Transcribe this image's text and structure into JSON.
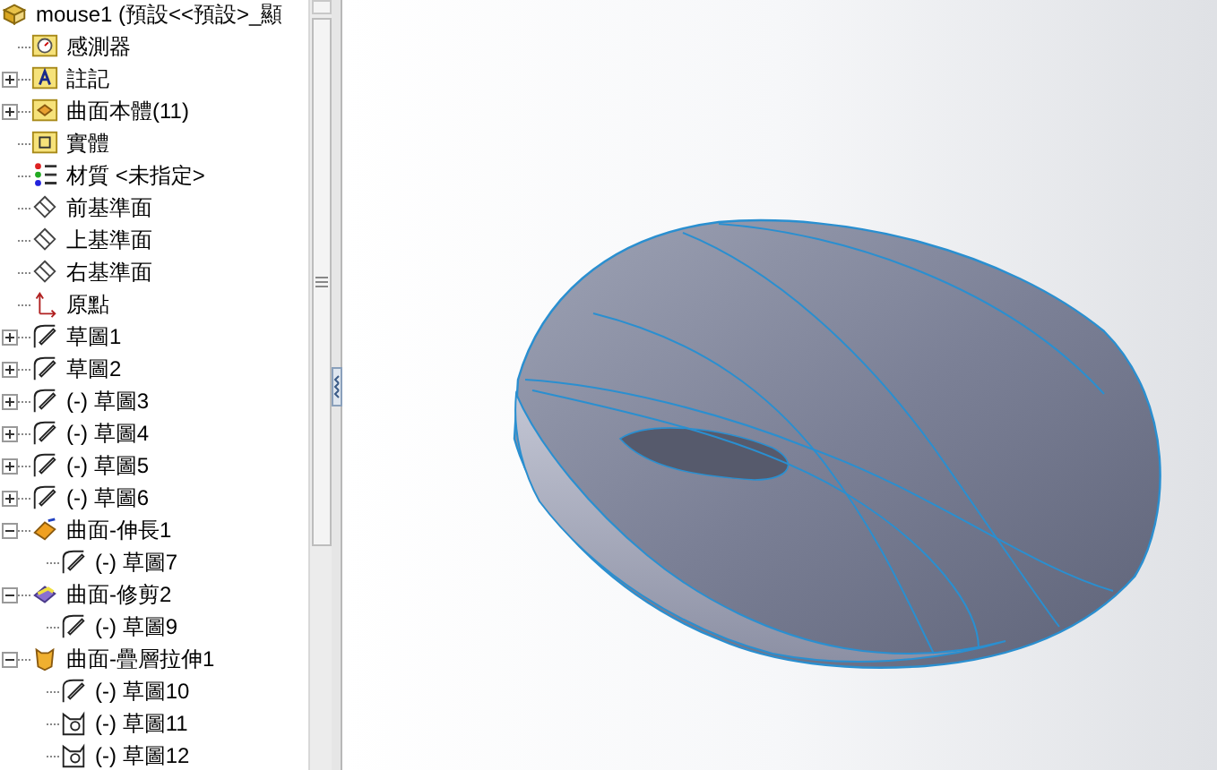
{
  "tree": {
    "root": {
      "label": "mouse1 (預設<<預設>_顯"
    },
    "items": [
      {
        "label": "感測器",
        "kind": "sensor",
        "expandable": false
      },
      {
        "label": "註記",
        "kind": "annotation",
        "expandable": true,
        "expanded": false
      },
      {
        "label": "曲面本體(11)",
        "kind": "surface-bodies",
        "expandable": true,
        "expanded": false
      },
      {
        "label": "實體",
        "kind": "solid-bodies",
        "expandable": false
      },
      {
        "label": "材質 <未指定>",
        "kind": "material",
        "expandable": false
      },
      {
        "label": "前基準面",
        "kind": "plane",
        "expandable": false
      },
      {
        "label": "上基準面",
        "kind": "plane",
        "expandable": false
      },
      {
        "label": "右基準面",
        "kind": "plane",
        "expandable": false
      },
      {
        "label": "原點",
        "kind": "origin",
        "expandable": false
      },
      {
        "label": "草圖1",
        "kind": "sketch",
        "expandable": true,
        "expanded": false
      },
      {
        "label": "草圖2",
        "kind": "sketch",
        "expandable": true,
        "expanded": false
      },
      {
        "label": "(-) 草圖3",
        "kind": "sketch",
        "expandable": true,
        "expanded": false
      },
      {
        "label": "(-) 草圖4",
        "kind": "sketch",
        "expandable": true,
        "expanded": false
      },
      {
        "label": "(-) 草圖5",
        "kind": "sketch",
        "expandable": true,
        "expanded": false
      },
      {
        "label": "(-) 草圖6",
        "kind": "sketch",
        "expandable": true,
        "expanded": false
      },
      {
        "label": "曲面-伸長1",
        "kind": "extrude",
        "expandable": true,
        "expanded": true,
        "children": [
          {
            "label": "(-) 草圖7",
            "kind": "sketch",
            "expandable": false
          }
        ]
      },
      {
        "label": "曲面-修剪2",
        "kind": "trim",
        "expandable": true,
        "expanded": true,
        "children": [
          {
            "label": "(-) 草圖9",
            "kind": "sketch",
            "expandable": false
          }
        ]
      },
      {
        "label": "曲面-疊層拉伸1",
        "kind": "loft",
        "expandable": true,
        "expanded": true,
        "children": [
          {
            "label": "(-) 草圖10",
            "kind": "sketch",
            "expandable": false
          },
          {
            "label": "(-) 草圖11",
            "kind": "sketch3d",
            "expandable": false
          },
          {
            "label": "(-) 草圖12",
            "kind": "sketch3d",
            "expandable": false
          }
        ]
      }
    ]
  }
}
